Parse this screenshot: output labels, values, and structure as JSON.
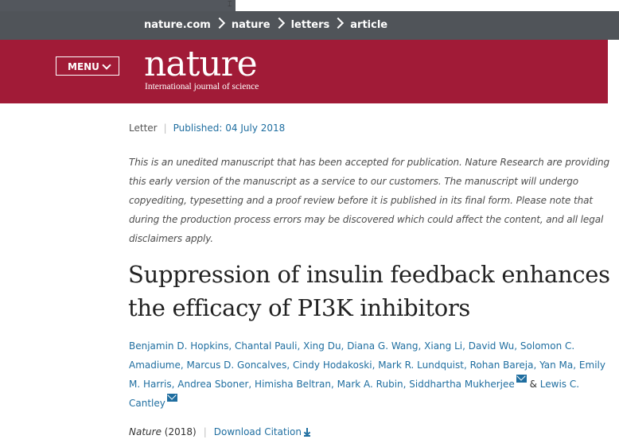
{
  "breadcrumb": [
    "nature.com",
    "nature",
    "letters",
    "article"
  ],
  "header": {
    "menu_label": "MENU",
    "logo": "nature",
    "tagline": "International journal of science"
  },
  "article": {
    "type": "Letter",
    "published": "Published: 04 July 2018",
    "notice": "This is an unedited manuscript that has been accepted for publication. Nature Research are providing this early version of the manuscript as a service to our customers. The manuscript will undergo copyediting, typesetting and a proof review before it is published in its final form. Please note that during the production process errors may be discovered which could affect the content, and all legal disclaimers apply.",
    "title": "Suppression of insulin feedback enhances the efficacy of PI3K inhibitors",
    "authors": [
      "Benjamin D. Hopkins",
      "Chantal Pauli",
      "Xing Du",
      "Diana G. Wang",
      "Xiang Li",
      "David Wu",
      "Solomon C. Amadiume",
      "Marcus D. Goncalves",
      "Cindy Hodakoski",
      "Mark R. Lundquist",
      "Rohan Bareja",
      "Yan Ma",
      "Emily M. Harris",
      "Andrea Sboner",
      "Himisha Beltran",
      "Mark A. Rubin",
      "Siddhartha Mukherjee",
      "Lewis C. Cantley"
    ],
    "author_separator": ", ",
    "author_last_joiner": " & ",
    "corresponding_authors": [
      16,
      17
    ],
    "journal": "Nature",
    "year": "(2018)",
    "download_citation": "Download Citation"
  },
  "colors": {
    "masthead": "#a11b37",
    "crumbbar": "#505459",
    "link": "#1f6ea0"
  }
}
